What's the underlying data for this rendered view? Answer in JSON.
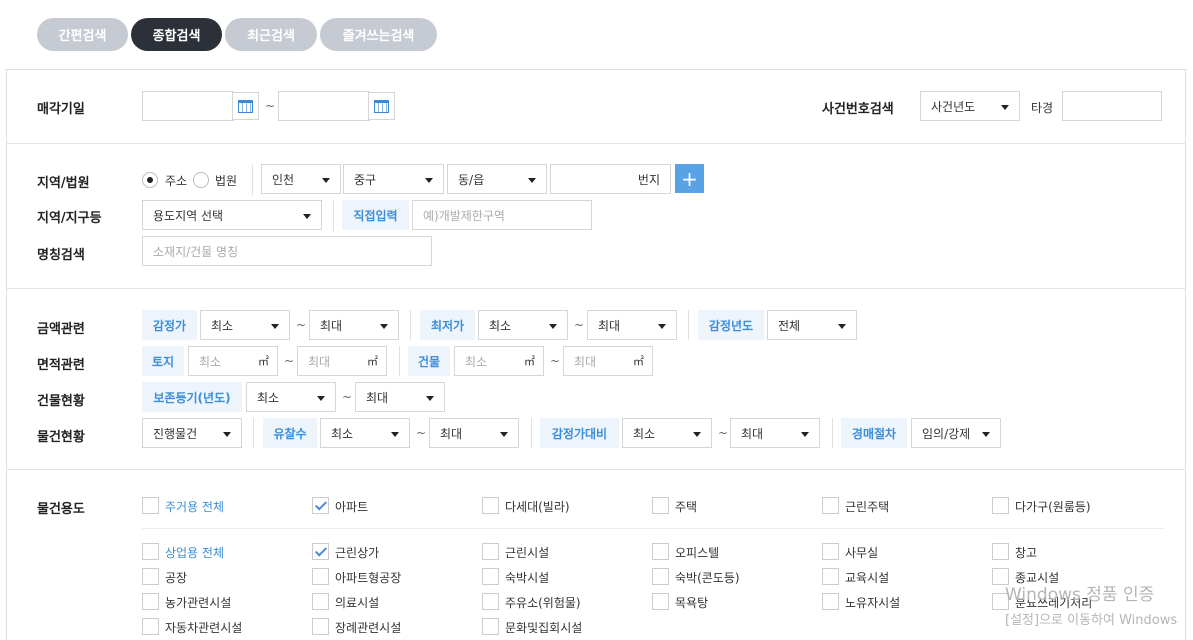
{
  "tabs": [
    "간편검색",
    "종합검색",
    "최근검색",
    "즐겨쓰는검색"
  ],
  "sale_date": {
    "label": "매각기일",
    "tilde": "~"
  },
  "case_search": {
    "label": "사건번호검색",
    "year_select": "사건년도",
    "tagyeong": "타경"
  },
  "region": {
    "label": "지역/법원",
    "radio_address": "주소",
    "radio_court": "법원",
    "sido": "인천",
    "sigungu": "중구",
    "dong": "동/읍",
    "bunji": "번지",
    "plus": "+"
  },
  "zone": {
    "label": "지역/지구등",
    "select": "용도지역 선택",
    "direct_input": "직접입력",
    "placeholder": "예)개발제한구역"
  },
  "name_search": {
    "label": "명칭검색",
    "placeholder": "소재지/건물 명칭"
  },
  "price": {
    "label": "금액관련",
    "appraisal": "감정가",
    "min": "최소",
    "max": "최대",
    "lowest": "최저가",
    "appraisal_year": "감정년도",
    "all": "전체"
  },
  "area": {
    "label": "면적관련",
    "land": "토지",
    "building": "건물",
    "unit": "㎡",
    "min": "최소",
    "max": "최대"
  },
  "building_status": {
    "label": "건물현황",
    "registry": "보존등기(년도)",
    "min": "최소",
    "max": "최대"
  },
  "item_status": {
    "label": "물건현황",
    "progress": "진행물건",
    "failed": "유찰수",
    "ratio": "감정가대비",
    "procedure": "경매절차",
    "procedure_value": "임의/강제",
    "min": "최소",
    "max": "최대"
  },
  "usage": {
    "label": "물건용도",
    "row1": [
      {
        "label": "주거용 전체",
        "checked": false,
        "blue": true
      },
      {
        "label": "아파트",
        "checked": true,
        "blue": false
      },
      {
        "label": "다세대(빌라)",
        "checked": false,
        "blue": false
      },
      {
        "label": "주택",
        "checked": false,
        "blue": false
      },
      {
        "label": "근린주택",
        "checked": false,
        "blue": false
      },
      {
        "label": "다가구(원룸등)",
        "checked": false,
        "blue": false
      }
    ],
    "rows2": [
      [
        {
          "label": "상업용 전체",
          "checked": false,
          "blue": true
        },
        {
          "label": "근린상가",
          "checked": true,
          "blue": false
        },
        {
          "label": "근린시설",
          "checked": false,
          "blue": false
        },
        {
          "label": "오피스텔",
          "checked": false,
          "blue": false
        },
        {
          "label": "사무실",
          "checked": false,
          "blue": false
        },
        {
          "label": "창고",
          "checked": false,
          "blue": false
        }
      ],
      [
        {
          "label": "공장",
          "checked": false,
          "blue": false
        },
        {
          "label": "아파트형공장",
          "checked": false,
          "blue": false
        },
        {
          "label": "숙박시설",
          "checked": false,
          "blue": false
        },
        {
          "label": "숙박(콘도등)",
          "checked": false,
          "blue": false
        },
        {
          "label": "교육시설",
          "checked": false,
          "blue": false
        },
        {
          "label": "종교시설",
          "checked": false,
          "blue": false
        }
      ],
      [
        {
          "label": "농가관련시설",
          "checked": false,
          "blue": false
        },
        {
          "label": "의료시설",
          "checked": false,
          "blue": false
        },
        {
          "label": "주유소(위험물)",
          "checked": false,
          "blue": false
        },
        {
          "label": "목욕탕",
          "checked": false,
          "blue": false
        },
        {
          "label": "노유자시설",
          "checked": false,
          "blue": false
        },
        {
          "label": "분뇨쓰레기처리",
          "checked": false,
          "blue": false
        }
      ],
      [
        {
          "label": "자동차관련시설",
          "checked": false,
          "blue": false
        },
        {
          "label": "장례관련시설",
          "checked": false,
          "blue": false
        },
        {
          "label": "문화및집회시설",
          "checked": false,
          "blue": false
        }
      ]
    ]
  },
  "watermark": {
    "line1": "Windows 정품 인증",
    "line2": "[설정]으로 이동하여 Windows"
  }
}
